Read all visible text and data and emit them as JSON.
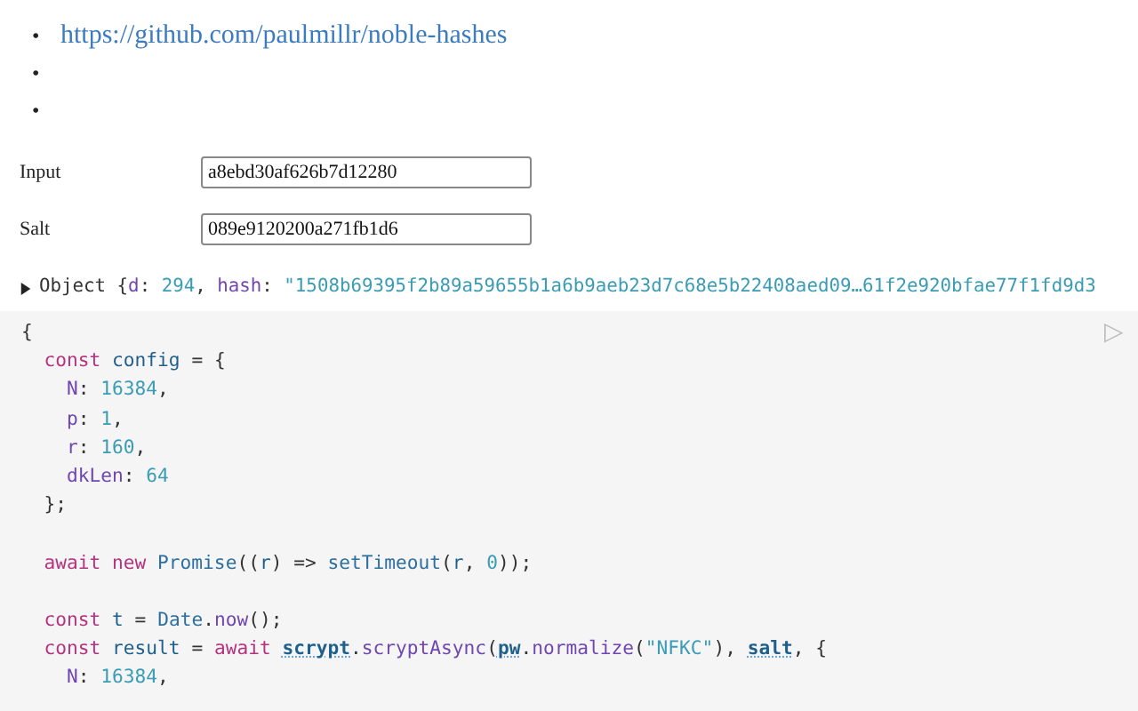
{
  "links": [
    {
      "marker": "•",
      "text": "https://github.com/paulmillr/noble-hashes"
    },
    {
      "marker": "•"
    },
    {
      "marker": "•"
    }
  ],
  "fields": [
    {
      "label": "Input",
      "value": "a8ebd30af626b7d12280"
    },
    {
      "label": "Salt",
      "value": "089e9120200a271fb1d6"
    }
  ],
  "inspector": {
    "expanded": false,
    "tokens": [
      {
        "kind": "t",
        "text": "Object {"
      },
      {
        "kind": "p",
        "text": "d"
      },
      {
        "kind": "t",
        "text": ": "
      },
      {
        "kind": "n",
        "text": "294"
      },
      {
        "kind": "t",
        "text": ", "
      },
      {
        "kind": "p",
        "text": "hash"
      },
      {
        "kind": "t",
        "text": ": "
      },
      {
        "kind": "s",
        "text": "\"1508b69395f2b89a59655b1a6b9aeb23d7c68e5b22408aed09…61f2e920bfae77f1fd9d3"
      }
    ]
  },
  "run_button": "▷",
  "code_blocks": [
    [
      [
        {
          "kind": "t",
          "text": "{"
        }
      ],
      [
        {
          "kind": "k",
          "text": "  const "
        },
        {
          "kind": "v",
          "text": "config"
        },
        {
          "kind": "t",
          "text": " = {"
        }
      ],
      [
        {
          "kind": "p",
          "text": "    N"
        },
        {
          "kind": "t",
          "text": ": "
        },
        {
          "kind": "n",
          "text": "16384"
        },
        {
          "kind": "t",
          "text": ","
        }
      ],
      [
        {
          "kind": "p",
          "text": "    p"
        },
        {
          "kind": "t",
          "text": ": "
        },
        {
          "kind": "n",
          "text": "1"
        },
        {
          "kind": "t",
          "text": ","
        }
      ],
      [
        {
          "kind": "p",
          "text": "    r"
        },
        {
          "kind": "t",
          "text": ": "
        },
        {
          "kind": "n",
          "text": "160"
        },
        {
          "kind": "t",
          "text": ","
        }
      ],
      [
        {
          "kind": "p",
          "text": "    dkLen"
        },
        {
          "kind": "t",
          "text": ": "
        },
        {
          "kind": "n",
          "text": "64"
        }
      ],
      [
        {
          "kind": "t",
          "text": "  };"
        }
      ]
    ],
    [
      [
        {
          "kind": "k",
          "text": "  await new "
        },
        {
          "kind": "f",
          "text": "Promise"
        },
        {
          "kind": "t",
          "text": "(("
        },
        {
          "kind": "v",
          "text": "r"
        },
        {
          "kind": "t",
          "text": ") => "
        },
        {
          "kind": "f",
          "text": "setTimeout"
        },
        {
          "kind": "t",
          "text": "("
        },
        {
          "kind": "v",
          "text": "r"
        },
        {
          "kind": "t",
          "text": ", "
        },
        {
          "kind": "n",
          "text": "0"
        },
        {
          "kind": "t",
          "text": "));"
        }
      ]
    ],
    [
      [
        {
          "kind": "k",
          "text": "  const "
        },
        {
          "kind": "v",
          "text": "t"
        },
        {
          "kind": "t",
          "text": " = "
        },
        {
          "kind": "f",
          "text": "Date"
        },
        {
          "kind": "t",
          "text": "."
        },
        {
          "kind": "p",
          "text": "now"
        },
        {
          "kind": "t",
          "text": "();"
        }
      ],
      [
        {
          "kind": "k",
          "text": "  const "
        },
        {
          "kind": "v",
          "text": "result"
        },
        {
          "kind": "t",
          "text": " = "
        },
        {
          "kind": "k",
          "text": "await "
        },
        {
          "kind": "r",
          "text": "scrypt"
        },
        {
          "kind": "t",
          "text": "."
        },
        {
          "kind": "p",
          "text": "scryptAsync"
        },
        {
          "kind": "t",
          "text": "("
        },
        {
          "kind": "r",
          "text": "pw"
        },
        {
          "kind": "t",
          "text": "."
        },
        {
          "kind": "p",
          "text": "normalize"
        },
        {
          "kind": "t",
          "text": "("
        },
        {
          "kind": "s",
          "text": "\"NFKC\""
        },
        {
          "kind": "t",
          "text": "), "
        },
        {
          "kind": "r",
          "text": "salt"
        },
        {
          "kind": "t",
          "text": ", {"
        }
      ],
      [
        {
          "kind": "p",
          "text": "    N"
        },
        {
          "kind": "t",
          "text": ": "
        },
        {
          "kind": "n",
          "text": "16384"
        },
        {
          "kind": "t",
          "text": ","
        }
      ]
    ]
  ]
}
